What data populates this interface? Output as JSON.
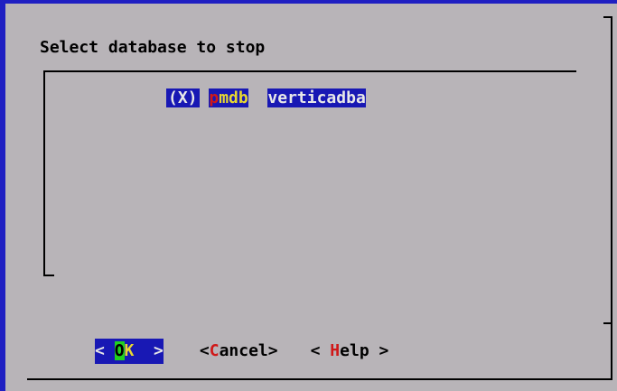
{
  "dialog": {
    "title": "Select database to stop"
  },
  "list": {
    "items": [
      {
        "selected_marker": "(X)",
        "db_hotkey": "p",
        "db_rest": "mdb",
        "owner": "verticadba"
      }
    ]
  },
  "buttons": {
    "ok": {
      "left": "< ",
      "hotkey": "O",
      "rest": "K",
      "right": "  >"
    },
    "cancel": {
      "left": "<",
      "hotkey": "C",
      "rest": "ancel>"
    },
    "help": {
      "left": "< ",
      "hotkey": "H",
      "rest": "elp >"
    }
  },
  "colors": {
    "background": "#b8b4b8",
    "highlight": "#1818b4",
    "hotkey_red": "#d01818",
    "hotkey_yellow": "#e8d830",
    "ok_hotkey_bg": "#20d020"
  }
}
